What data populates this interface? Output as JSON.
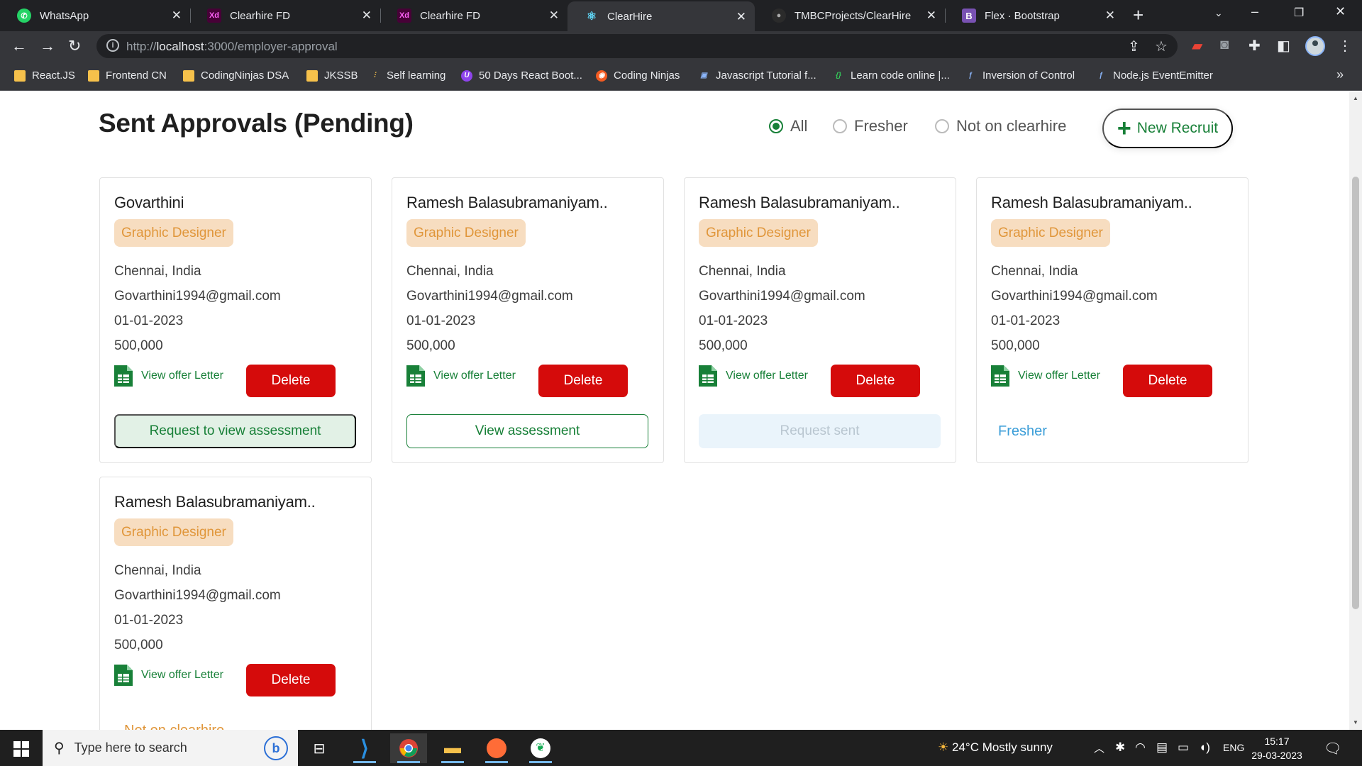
{
  "browser": {
    "tabs": [
      {
        "title": "WhatsApp",
        "favicon": "whatsapp-icon",
        "active": false
      },
      {
        "title": "Clearhire FD",
        "favicon": "adobe-xd-icon",
        "active": false
      },
      {
        "title": "Clearhire FD",
        "favicon": "adobe-xd-icon",
        "active": false
      },
      {
        "title": "ClearHire",
        "favicon": "react-icon",
        "active": true
      },
      {
        "title": "TMBCProjects/ClearHire",
        "favicon": "github-icon",
        "active": false
      },
      {
        "title": "Flex · Bootstrap",
        "favicon": "bootstrap-icon",
        "active": false
      }
    ],
    "url_prefix": "http://",
    "url_host": "localhost",
    "url_path": ":3000/employer-approval",
    "bookmarks": [
      {
        "label": "React.JS",
        "icon": "folder-icon"
      },
      {
        "label": "Frontend CN",
        "icon": "folder-icon"
      },
      {
        "label": "CodingNinjas DSA",
        "icon": "folder-icon"
      },
      {
        "label": "JKSSB",
        "icon": "folder-icon"
      },
      {
        "label": "Self learning",
        "icon": "bookmark-icon"
      },
      {
        "label": "50 Days React Boot...",
        "icon": "bookmark-icon"
      },
      {
        "label": "Coding Ninjas",
        "icon": "bookmark-icon"
      },
      {
        "label": "Javascript Tutorial f...",
        "icon": "bookmark-icon"
      },
      {
        "label": "Learn code online |...",
        "icon": "bookmark-icon"
      },
      {
        "label": "Inversion of Control",
        "icon": "bookmark-icon"
      },
      {
        "label": "Node.js EventEmitter",
        "icon": "bookmark-icon"
      }
    ]
  },
  "page": {
    "title": "Sent Approvals (Pending)",
    "filters": [
      {
        "label": "All",
        "selected": true
      },
      {
        "label": "Fresher",
        "selected": false
      },
      {
        "label": "Not on clearhire",
        "selected": false
      }
    ],
    "new_recruit_label": "New Recruit",
    "offer_link_label": "View offer Letter",
    "delete_label": "Delete",
    "cards": [
      {
        "name": "Govarthini",
        "role": "Graphic Designer",
        "location": "Chennai, India",
        "email": "Govarthini1994@gmail.com",
        "date": "01-01-2023",
        "salary": "500,000",
        "action": "Request to view assessment",
        "action_type": "request"
      },
      {
        "name": "Ramesh Balasubramaniyam..",
        "role": "Graphic Designer",
        "location": "Chennai, India",
        "email": "Govarthini1994@gmail.com",
        "date": "01-01-2023",
        "salary": "500,000",
        "action": "View assessment",
        "action_type": "view"
      },
      {
        "name": "Ramesh Balasubramaniyam..",
        "role": "Graphic Designer",
        "location": "Chennai, India",
        "email": "Govarthini1994@gmail.com",
        "date": "01-01-2023",
        "salary": "500,000",
        "action": "Request sent",
        "action_type": "sent"
      },
      {
        "name": "Ramesh Balasubramaniyam..",
        "role": "Graphic Designer",
        "location": "Chennai, India",
        "email": "Govarthini1994@gmail.com",
        "date": "01-01-2023",
        "salary": "500,000",
        "action": "Fresher",
        "action_type": "fresher"
      },
      {
        "name": "Ramesh Balasubramaniyam..",
        "role": "Graphic Designer",
        "location": "Chennai, India",
        "email": "Govarthini1994@gmail.com",
        "date": "01-01-2023",
        "salary": "500,000",
        "action": "Not on clearhire",
        "action_type": "notclear"
      }
    ],
    "colors": {
      "primary_green": "#188038",
      "delete_red": "#d50b0b",
      "role_bg": "#f7ddc0",
      "role_text": "#e0963a",
      "fresher_blue": "#3c9ed8"
    }
  },
  "taskbar": {
    "search_placeholder": "Type here to search",
    "apps": [
      "task-view-icon",
      "vscode-icon",
      "chrome-icon",
      "file-explorer-icon",
      "postman-icon",
      "mongodb-compass-icon"
    ],
    "weather": "24°C  Mostly sunny",
    "language": "ENG",
    "time": "15:17",
    "date": "29-03-2023"
  }
}
